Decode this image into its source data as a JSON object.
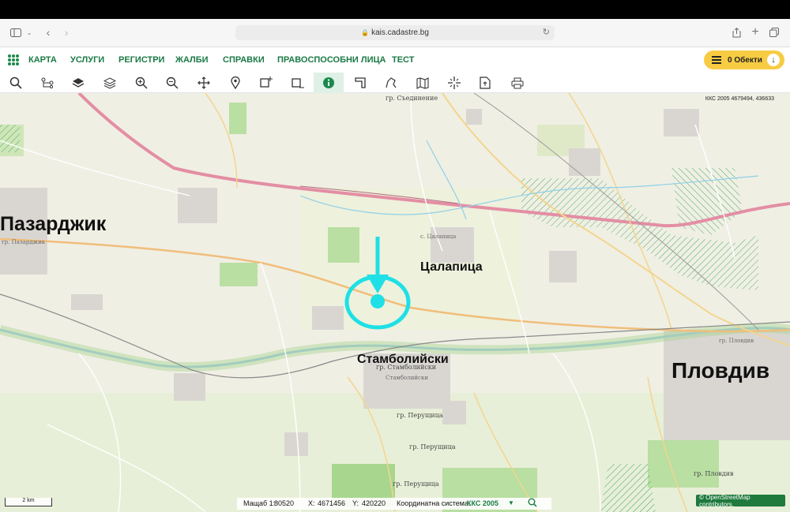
{
  "browser": {
    "url": "kais.cadastre.bg"
  },
  "nav": {
    "items": [
      "КАРТА",
      "УСЛУГИ",
      "РЕГИСТРИ",
      "ЖАЛБИ",
      "СПРАВКИ",
      "ПРАВОСПОСОБНИ ЛИЦА",
      "ТЕСТ"
    ],
    "objects_label": "0 Обекти"
  },
  "toolbar": {
    "tools": [
      "search-icon",
      "tree-icon",
      "layers-filled-icon",
      "layers-icon",
      "zoom-in-icon",
      "zoom-out-icon",
      "pan-icon",
      "pin-icon",
      "select-rect-plus-icon",
      "select-rect-minus-icon",
      "info-icon",
      "area-icon",
      "measure-icon",
      "map-icon",
      "crosshair-icon",
      "export-icon",
      "print-icon"
    ],
    "active_tool": "info-icon"
  },
  "map": {
    "corner_coords": "ККС 2005 4679494, 436633",
    "big_labels": {
      "pazardzhik": "Пазарджик",
      "tsalapitsa": "Цалапица",
      "stamboliyski": "Стамболийски",
      "plovdiv": "Пловдив"
    },
    "small_labels": {
      "saedinenie": "гр. Съединение",
      "tsalapitsa_village": "с. Цалапица",
      "stamboliyski_town": "гр. Стамболийски",
      "stamboliyski_town2": "Стамболийски",
      "perushtitsa1": "гр. Перущица",
      "perushtitsa2": "гр. Перущица",
      "perushtitsa3": "гр. Перущица",
      "plovdiv_town": "гр. Пловдив",
      "plovdiv_town2": "гр. Пловдив",
      "pazardzhik_town": "гр. Пазарджик"
    },
    "marker_color": "#1ee0e6"
  },
  "status": {
    "scale_label": "Мащаб 1:",
    "scale_value": "80520",
    "x_label": "X:",
    "x_value": "4671456",
    "y_label": "Y:",
    "y_value": "420220",
    "crs_label": "Координатна система:",
    "crs_value": "ККС 2005",
    "scalebar": "2 km",
    "osm_credit": "© OpenStreetMap contributors."
  }
}
